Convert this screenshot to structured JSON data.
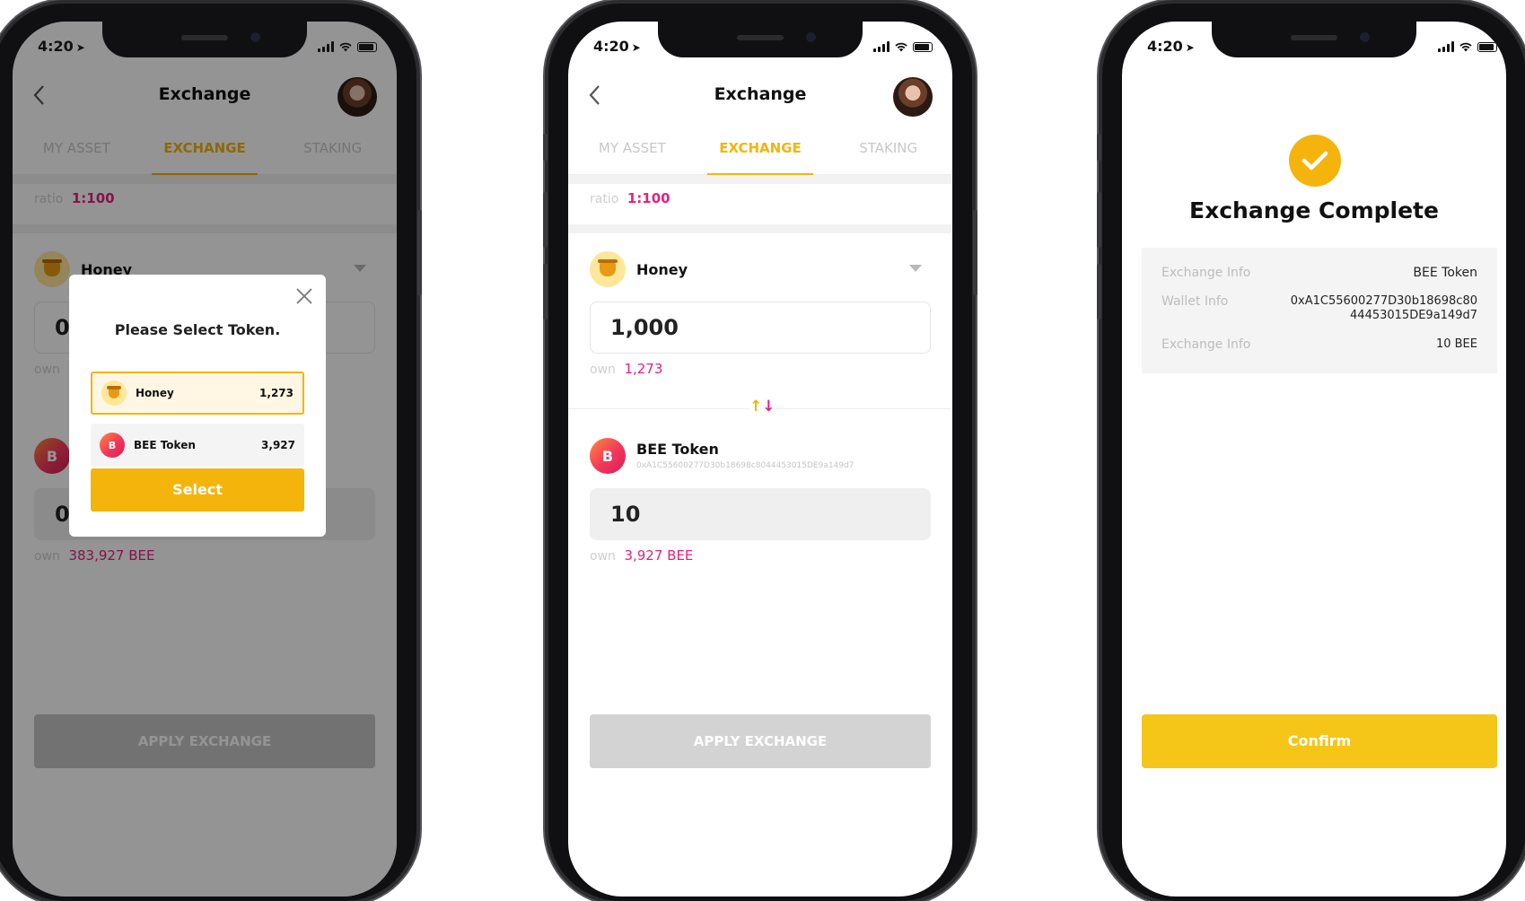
{
  "status_time": "4:20",
  "screen1": {
    "title": "Exchange",
    "tabs": [
      "MY ASSET",
      "EXCHANGE",
      "STAKING"
    ],
    "ratio_label": "ratio",
    "ratio_value": "1:100",
    "token_name": "Honey",
    "from_amount": "0",
    "own_label": "own",
    "to_amount": "0",
    "to_own_value": "383,927 BEE",
    "apply_label": "APPLY EXCHANGE",
    "modal": {
      "title": "Please Select Token.",
      "options": [
        {
          "name": "Honey",
          "balance": "1,273"
        },
        {
          "name": "BEE Token",
          "balance": "3,927"
        }
      ],
      "select_label": "Select"
    }
  },
  "screen2": {
    "title": "Exchange",
    "tabs": [
      "MY ASSET",
      "EXCHANGE",
      "STAKING"
    ],
    "ratio_label": "ratio",
    "ratio_value": "1:100",
    "from_token": "Honey",
    "from_amount": "1,000",
    "own_label": "own",
    "from_own_value": "1,273",
    "to_token": "BEE Token",
    "to_address": "0xA1C55600277D30b18698c8044453015DE9a149d7",
    "to_amount": "10",
    "to_own_value": "3,927 BEE",
    "apply_label": "APPLY EXCHANGE"
  },
  "screen3": {
    "title": "Exchange Complete",
    "info": [
      {
        "label": "Exchange Info",
        "value": "BEE Token"
      },
      {
        "label": "Wallet Info",
        "value_line1": "0xA1C55600277D30b18698c80",
        "value_line2": "44453015DE9a149d7"
      },
      {
        "label": "Exchange Info",
        "value": "10 BEE"
      }
    ],
    "confirm_label": "Confirm"
  },
  "colors": {
    "accent": "#f5b40c",
    "pink": "#e8207f",
    "disabled": "#d3d3d3",
    "confirm": "#f5c518"
  },
  "icons": [
    "back-chevron-icon",
    "checkmark-icon",
    "close-icon",
    "dropdown-caret-icon",
    "swap-arrows-icon",
    "honey-pot-icon",
    "bee-token-icon",
    "signal-icon",
    "wifi-icon",
    "battery-icon",
    "location-arrow-icon"
  ]
}
